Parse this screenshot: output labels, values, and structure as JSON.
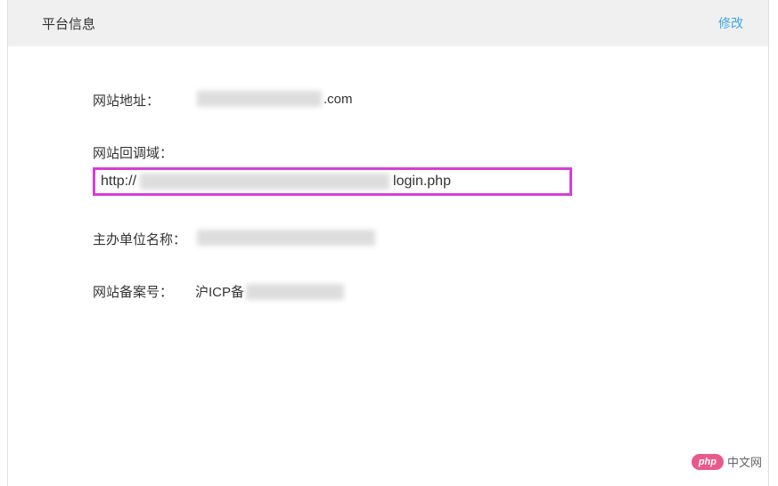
{
  "header": {
    "title": "平台信息",
    "action": "修改"
  },
  "fields": {
    "website_url": {
      "label": "网站地址：",
      "suffix": ".com"
    },
    "callback_domain": {
      "label": "网站回调域：",
      "prefix": "http://",
      "suffix": "login.php"
    },
    "organizer": {
      "label": "主办单位名称："
    },
    "icp": {
      "label": "网站备案号：",
      "prefix": "沪ICP备"
    }
  },
  "watermark": {
    "badge": "php",
    "text": "中文网"
  }
}
